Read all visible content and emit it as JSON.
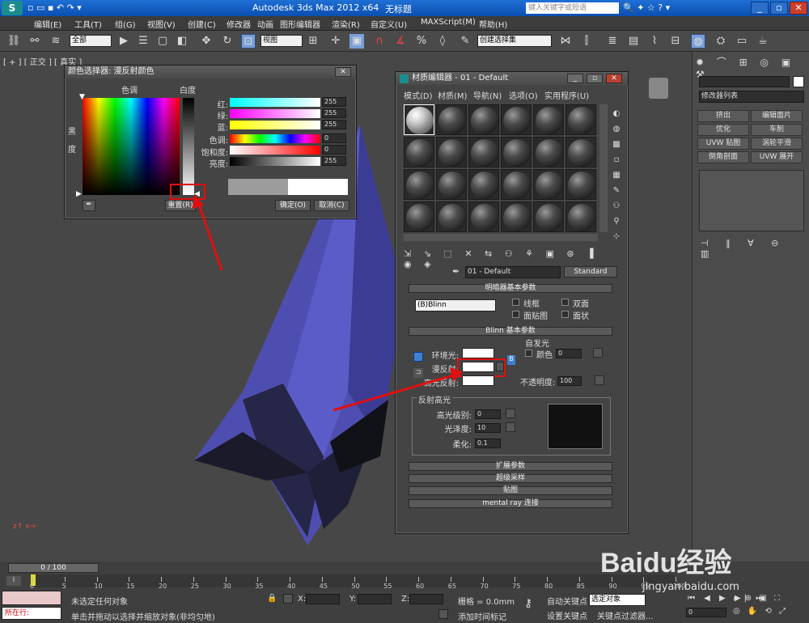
{
  "app": {
    "title": "Autodesk 3ds Max  2012 x64",
    "file": "无标题",
    "search_placeholder": "键入关键字或短语"
  },
  "menu": [
    "编辑(E)",
    "工具(T)",
    "组(G)",
    "视图(V)",
    "创建(C)",
    "修改器",
    "动画",
    "图形编辑器",
    "渲染(R)",
    "自定义(U)",
    "MAXScript(M)",
    "帮助(H)"
  ],
  "toolbar": {
    "filter": "全部",
    "refcoord": "视图",
    "selset": "创建选择集"
  },
  "viewport": {
    "label": "[ + ] [ 正交 ] [ 真实 ]"
  },
  "color_picker": {
    "title": "颜色选择器: 漫反射颜色",
    "hue_label": "色调",
    "whiteness_label": "白度",
    "blackness_label": "黑度",
    "rows": [
      {
        "label": "红:",
        "value": "255"
      },
      {
        "label": "绿:",
        "value": "255"
      },
      {
        "label": "蓝:",
        "value": "255"
      },
      {
        "label": "色调:",
        "value": "0"
      },
      {
        "label": "饱和度:",
        "value": "0"
      },
      {
        "label": "亮度:",
        "value": "255"
      }
    ],
    "reset": "重置(R)",
    "ok": "确定(O)",
    "cancel": "取消(C)"
  },
  "mat_editor": {
    "title": "材质编辑器 - 01 - Default",
    "menu": [
      "模式(D)",
      "材质(M)",
      "导航(N)",
      "选项(O)",
      "实用程序(U)"
    ],
    "material_name": "01 - Default",
    "material_type": "Standard",
    "shader_rollout": "明暗器基本参数",
    "shader": "(B)Blinn",
    "wire": "线框",
    "two_sided": "双面",
    "face_map": "面贴图",
    "faceted": "面状",
    "blinn_rollout": "Blinn 基本参数",
    "self_illum": "自发光",
    "color_label": "颜色",
    "self_illum_value": "0",
    "ambient": "环境光:",
    "diffuse": "漫反射:",
    "specular": "高光反射:",
    "opacity_label": "不透明度:",
    "opacity": "100",
    "spec_group": "反射高光",
    "spec_level_label": "高光级别:",
    "spec_level": "0",
    "gloss_label": "光泽度:",
    "gloss": "10",
    "soften_label": "柔化:",
    "soften": "0.1",
    "rollouts": [
      "扩展参数",
      "超级采样",
      "贴图",
      "mental ray 连接"
    ]
  },
  "cmd_panel": {
    "modifier_list": "修改器列表",
    "buttons": [
      "挤出",
      "编辑面片",
      "优化",
      "车削",
      "UVW 贴图",
      "涡轮平滑",
      "倒角剖面",
      "UVW 展开"
    ]
  },
  "timeline": {
    "frame": "0 / 100",
    "ticks": [
      "0",
      "5",
      "10",
      "15",
      "20",
      "25",
      "30",
      "35",
      "40",
      "45",
      "50",
      "55",
      "60",
      "65",
      "70",
      "75",
      "80",
      "85",
      "90",
      "95",
      "100"
    ]
  },
  "status": {
    "running": "所在行:",
    "no_selection": "未选定任何对象",
    "prompt": "单击并拖动以选择并缩放对象(非均匀地)",
    "x": "X:",
    "y": "Y:",
    "z": "Z:",
    "grid": "栅格 = 0.0mm",
    "add_time_tag": "添加时间标记",
    "auto_key": "自动关键点",
    "selected": "选定对象",
    "set_key": "设置关键点",
    "key_filters": "关键点过滤器...",
    "frame_num": "0"
  },
  "watermark": {
    "brand": "Baidu经验",
    "url": "jingyan.baidu.com"
  }
}
